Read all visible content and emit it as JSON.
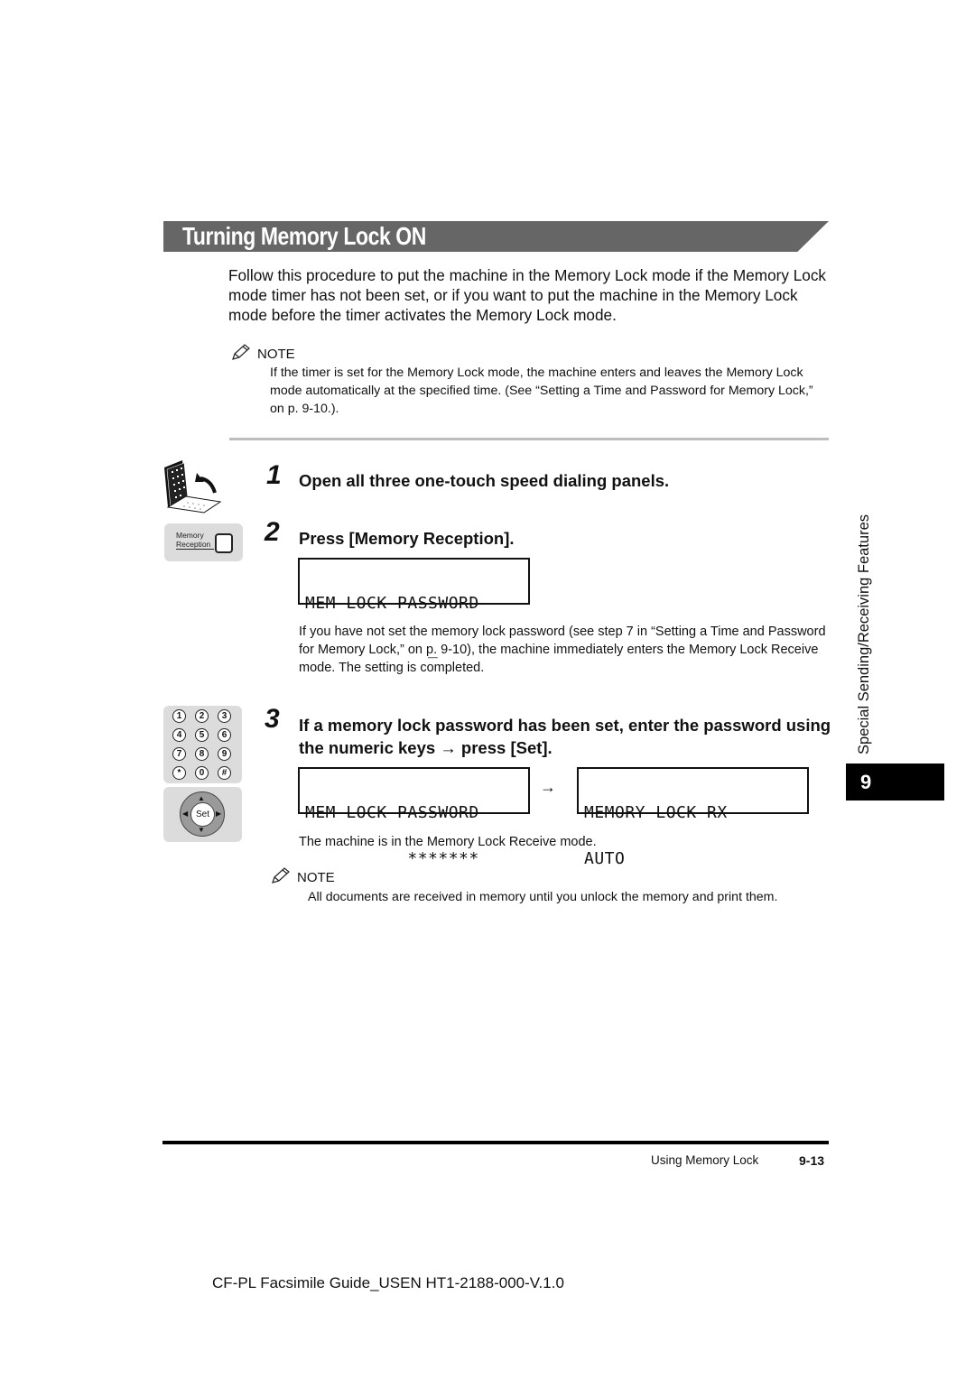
{
  "section": {
    "title": "Turning Memory Lock ON",
    "intro": "Follow this procedure to put the machine in the Memory Lock mode if the Memory Lock mode timer has not been set, or if you want to put the machine in the Memory Lock mode before the timer activates the Memory Lock mode."
  },
  "note1": {
    "label": "NOTE",
    "icon": "pencil-icon",
    "text": "If the timer is set for the Memory Lock mode, the machine enters and leaves the Memory Lock mode automatically at the specified time. (See “Setting a Time and Password for Memory Lock,” on p. 9-10.)."
  },
  "steps": [
    {
      "number": "1",
      "text": "Open all three one-touch speed dialing panels."
    },
    {
      "number": "2",
      "text": "Press [Memory Reception].",
      "lcd": {
        "line1": "MEM LOCK PASSWORD",
        "line2": "            _"
      },
      "detail": "If you have not set the memory lock password (see step 7 in “Setting a Time and Password for Memory Lock,” on p. 9-10), the machine immediately enters the Memory Lock Receive mode. The setting is completed."
    },
    {
      "number": "3",
      "text": "If a memory lock password has been set, enter the password using the numeric keys → press [Set].",
      "lcd_before": {
        "line1": "MEM LOCK PASSWORD",
        "line2": "          *******"
      },
      "arrow": "→",
      "lcd_after": {
        "line1": "MEMORY LOCK RX",
        "line2": "AUTO"
      },
      "detail": "The machine is in the Memory Lock Receive mode."
    }
  ],
  "note2": {
    "label": "NOTE",
    "icon": "pencil-icon",
    "text": "All documents are received in memory until you unlock the memory and print them."
  },
  "illustrations": {
    "memory_reception_button": {
      "line1": "Memory",
      "line2": "Reception"
    },
    "keypad": [
      "1",
      "2",
      "3",
      "4",
      "5",
      "6",
      "7",
      "8",
      "9",
      "*",
      "0",
      "#"
    ],
    "set_key": "Set"
  },
  "side_tab": {
    "chapter_title": "Special Sending/Receiving Features",
    "chapter_number": "9"
  },
  "footer": {
    "section_name": "Using Memory Lock",
    "page_number": "9-13",
    "document_id": "CF-PL Facsimile Guide_USEN HT1-2188-000-V.1.0"
  }
}
